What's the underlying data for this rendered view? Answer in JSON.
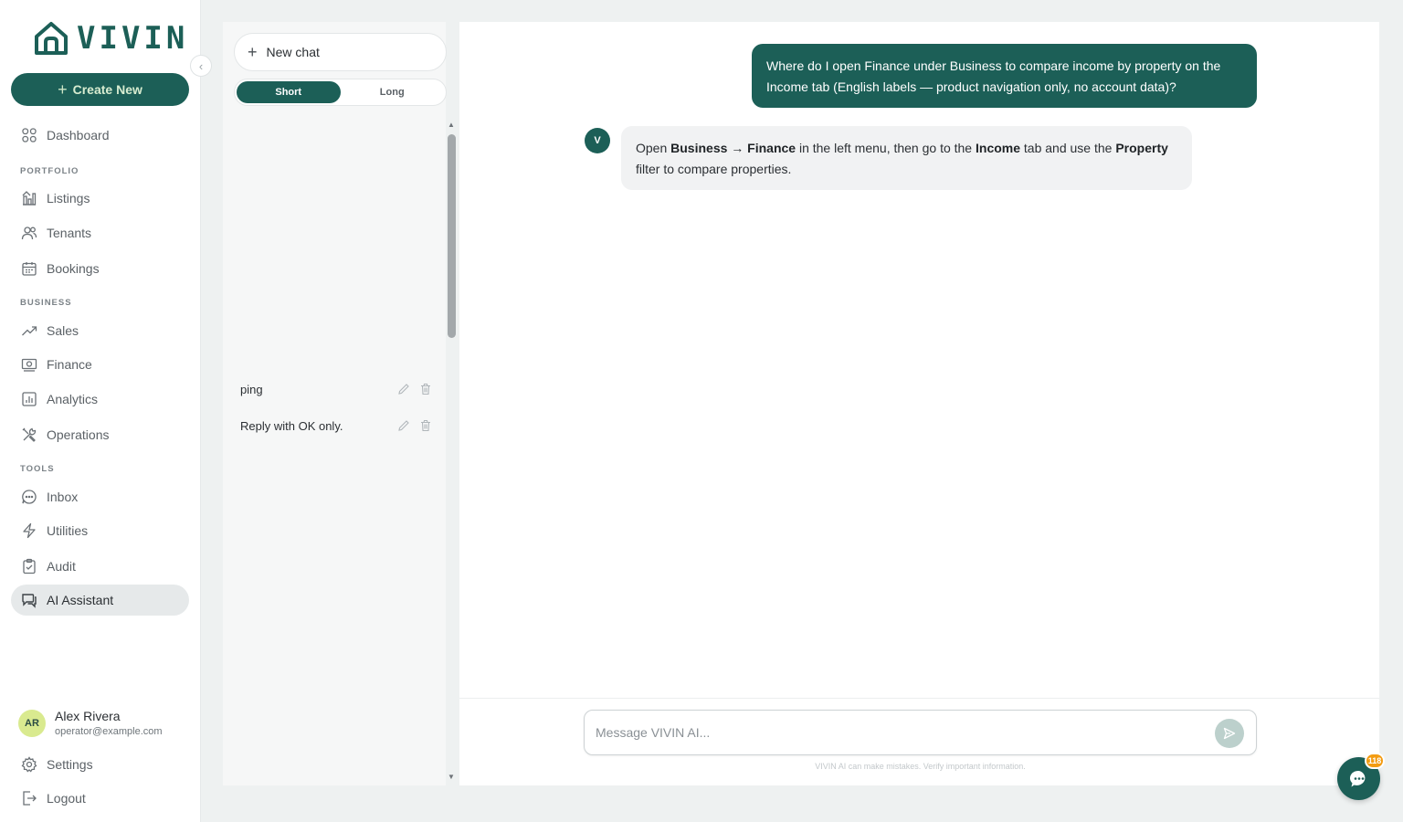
{
  "brand": {
    "name": "VIVIN",
    "accent": "#1c5f57"
  },
  "sidebar": {
    "create_label": "Create New",
    "dashboard": "Dashboard",
    "sections": {
      "portfolio": "PORTFOLIO",
      "business": "BUSINESS",
      "tools": "TOOLS"
    },
    "items": {
      "listings": "Listings",
      "tenants": "Tenants",
      "bookings": "Bookings",
      "sales": "Sales",
      "finance": "Finance",
      "analytics": "Analytics",
      "operations": "Operations",
      "inbox": "Inbox",
      "utilities": "Utilities",
      "audit": "Audit",
      "ai_assistant": "AI Assistant"
    },
    "active": "AI Assistant",
    "user": {
      "initials": "AR",
      "name": "Alex Rivera",
      "email": "operator@example.com"
    },
    "settings": "Settings",
    "logout": "Logout"
  },
  "chat_list": {
    "new_chat_label": "New chat",
    "toggle": {
      "short": "Short",
      "long": "Long",
      "selected": "Short"
    },
    "chats": [
      {
        "title": "ping"
      },
      {
        "title": "Reply with OK only."
      }
    ]
  },
  "conversation": {
    "user_message": "Where do I open Finance under Business to compare income by property on the Income tab (English labels — product navigation only, no account data)?",
    "assistant_initial": "V",
    "assistant_message": {
      "t1": "Open ",
      "b1": "Business → Finance",
      "t2": " in the left menu, then go to the ",
      "b2": "Income",
      "t3": " tab and use the ",
      "b3": "Property",
      "t4": " filter to compare properties."
    }
  },
  "composer": {
    "placeholder": "Message VIVIN AI...",
    "disclaimer": "VIVIN AI can make mistakes. Verify important information."
  },
  "support_widget": {
    "badge_count": "118"
  }
}
